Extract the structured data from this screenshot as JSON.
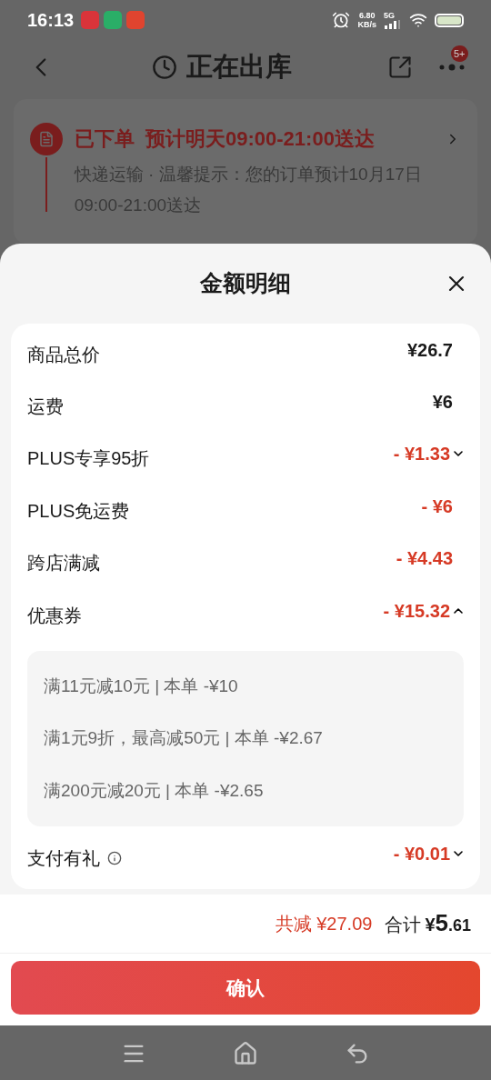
{
  "status_bar": {
    "time": "16:13",
    "speed": "6.80",
    "speed_unit": "KB/s",
    "network": "5G"
  },
  "header": {
    "title": "正在出库",
    "badge": "5+"
  },
  "order_card": {
    "status": "已下单",
    "eta": "预计明天09:00-21:00送达",
    "detail": "快递运输 · 温馨提示：您的订单预计10月17日09:00-21:00送达"
  },
  "sheet": {
    "title": "金额明细",
    "rows": [
      {
        "label": "商品总价",
        "amount": "¥26.7",
        "kind": "price"
      },
      {
        "label": "运费",
        "amount": "¥6",
        "kind": "price"
      },
      {
        "label": "PLUS专享95折",
        "amount": "- ¥1.33",
        "kind": "discount",
        "expanded": false
      },
      {
        "label": "PLUS免运费",
        "amount": "- ¥6",
        "kind": "discount"
      },
      {
        "label": "跨店满减",
        "amount": "- ¥4.43",
        "kind": "discount"
      },
      {
        "label": "优惠券",
        "amount": "- ¥15.32",
        "kind": "discount",
        "expanded": true,
        "children": [
          "满11元减10元 | 本单 -¥10",
          "满1元9折，最高减50元 | 本单 -¥2.67",
          "满200元减20元 | 本单 -¥2.65"
        ]
      },
      {
        "label": "支付有礼",
        "amount": "- ¥0.01",
        "kind": "discount",
        "info": true,
        "expanded": false
      }
    ]
  },
  "summary": {
    "reduced_label": "共减",
    "reduced_amount": "¥27.09",
    "total_label": "合计",
    "currency": "¥",
    "integer": "5",
    "decimal": ".61"
  },
  "confirm_button": "确认"
}
